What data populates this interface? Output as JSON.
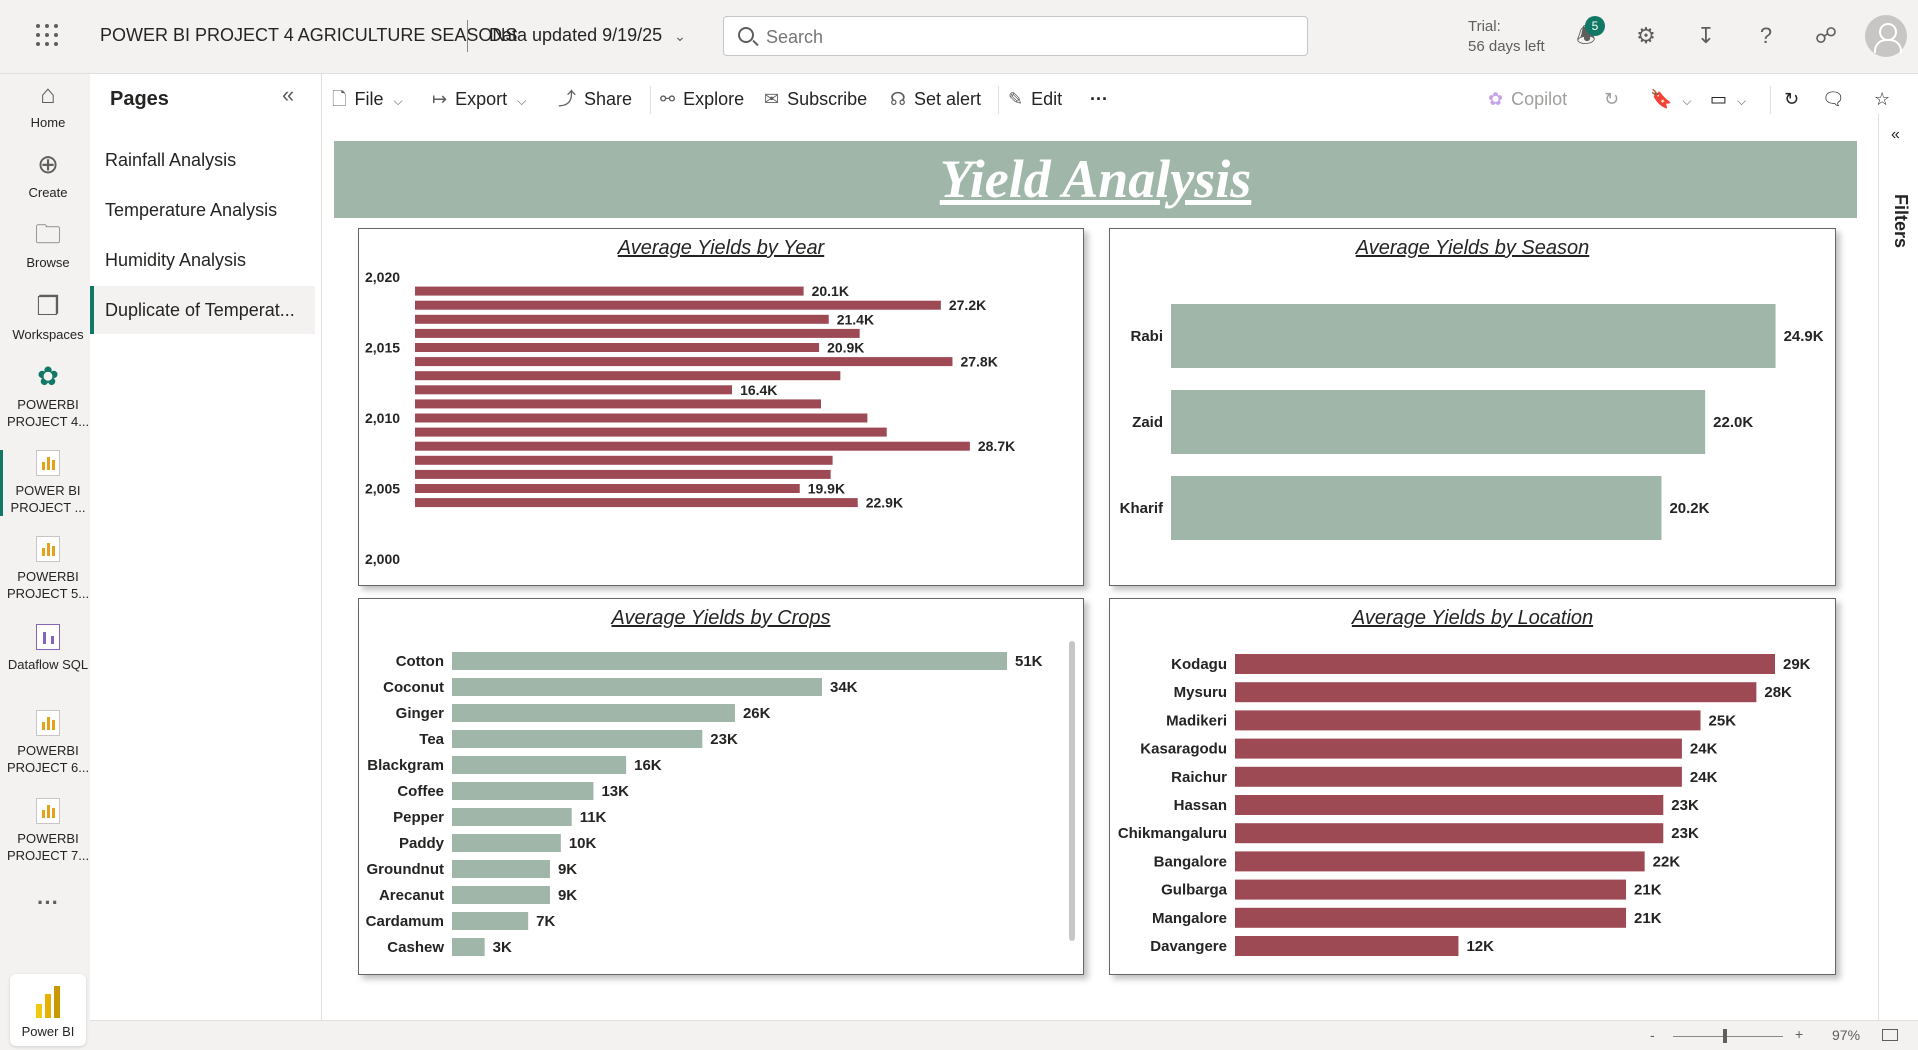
{
  "app": {
    "title": "POWER BI PROJECT 4 AGRICULTURE SEASONS",
    "data_updated": "Data updated 9/19/25",
    "search_placeholder": "Search",
    "trial_line1": "Trial:",
    "trial_line2": "56 days left",
    "notification_count": "5"
  },
  "leftnav": [
    {
      "label": "Home",
      "icon": "home-icon"
    },
    {
      "label": "Create",
      "icon": "plus-circle-icon"
    },
    {
      "label": "Browse",
      "icon": "folder-icon"
    },
    {
      "label": "Workspaces",
      "icon": "workspaces-icon"
    },
    {
      "label": "POWERBI PROJECT 4...",
      "icon": "workspace-group-icon"
    },
    {
      "label": "POWER BI PROJECT ...",
      "icon": "report-icon",
      "active": true
    },
    {
      "label": "POWERBI PROJECT 5...",
      "icon": "report-icon"
    },
    {
      "label": "Dataflow SQL",
      "icon": "dataflow-icon"
    },
    {
      "label": "POWERBI PROJECT 6...",
      "icon": "report-icon"
    },
    {
      "label": "POWERBI PROJECT 7...",
      "icon": "report-icon"
    }
  ],
  "leftnav_more": "···",
  "leftnav_brand": "Power BI",
  "pages": {
    "title": "Pages",
    "items": [
      {
        "label": "Rainfall Analysis"
      },
      {
        "label": "Temperature Analysis"
      },
      {
        "label": "Humidity Analysis"
      },
      {
        "label": "Duplicate of Temperat...",
        "active": true
      }
    ]
  },
  "toolbar": {
    "file": "File",
    "export": "Export",
    "share": "Share",
    "explore": "Explore",
    "subscribe": "Subscribe",
    "set_alert": "Set alert",
    "edit": "Edit",
    "more": "···",
    "copilot": "Copilot"
  },
  "filters_label": "Filters",
  "report": {
    "title": "Yield Analysis"
  },
  "colors": {
    "sage": "#9fb6a8",
    "maroon": "#9e4a54",
    "accent": "#117865"
  },
  "chart_data": [
    {
      "id": "year",
      "type": "bar",
      "orientation": "horizontal",
      "title": "Average Yields by Year",
      "axis_ticks": [
        "2,020",
        "2,015",
        "2,010",
        "2,005",
        "2,000"
      ],
      "ylim": [
        2000,
        2020
      ],
      "x": [
        2019,
        2018,
        2017,
        2016,
        2015,
        2014,
        2013,
        2012,
        2011,
        2010,
        2009,
        2008,
        2007,
        2006,
        2005,
        2004
      ],
      "values": [
        20100,
        27200,
        21400,
        23000,
        20900,
        27800,
        22000,
        16400,
        21000,
        23400,
        24400,
        28700,
        21600,
        21500,
        19900,
        22900
      ],
      "data_labels": [
        "20.1K",
        "27.2K",
        "21.4K",
        "",
        "20.9K",
        "27.8K",
        "",
        "16.4K",
        "",
        "",
        "",
        "28.7K",
        "",
        "",
        "19.9K",
        "22.9K"
      ],
      "color": "#9e4a54"
    },
    {
      "id": "season",
      "type": "bar",
      "orientation": "horizontal",
      "title": "Average Yields by Season",
      "categories": [
        "Rabi",
        "Zaid",
        "Kharif"
      ],
      "values": [
        24900,
        22000,
        20200
      ],
      "data_labels": [
        "24.9K",
        "22.0K",
        "20.2K"
      ],
      "color": "#9fb6a8"
    },
    {
      "id": "crops",
      "type": "bar",
      "orientation": "horizontal",
      "title": "Average Yields by Crops",
      "categories": [
        "Cotton",
        "Coconut",
        "Ginger",
        "Tea",
        "Blackgram",
        "Coffee",
        "Pepper",
        "Paddy",
        "Groundnut",
        "Arecanut",
        "Cardamum",
        "Cashew"
      ],
      "values": [
        51000,
        34000,
        26000,
        23000,
        16000,
        13000,
        11000,
        10000,
        9000,
        9000,
        7000,
        3000
      ],
      "data_labels": [
        "51K",
        "34K",
        "26K",
        "23K",
        "16K",
        "13K",
        "11K",
        "10K",
        "9K",
        "9K",
        "7K",
        "3K"
      ],
      "color": "#9fb6a8"
    },
    {
      "id": "location",
      "type": "bar",
      "orientation": "horizontal",
      "title": "Average Yields by Location",
      "categories": [
        "Kodagu",
        "Mysuru",
        "Madikeri",
        "Kasaragodu",
        "Raichur",
        "Hassan",
        "Chikmangaluru",
        "Bangalore",
        "Gulbarga",
        "Mangalore",
        "Davangere"
      ],
      "values": [
        29000,
        28000,
        25000,
        24000,
        24000,
        23000,
        23000,
        22000,
        21000,
        21000,
        12000
      ],
      "data_labels": [
        "29K",
        "28K",
        "25K",
        "24K",
        "24K",
        "23K",
        "23K",
        "22K",
        "21K",
        "21K",
        "12K"
      ],
      "color": "#9e4a54"
    }
  ],
  "status": {
    "zoom_minus": "-",
    "zoom_plus": "+",
    "zoom_level": "97%",
    "zoom_fraction": 0.45
  }
}
